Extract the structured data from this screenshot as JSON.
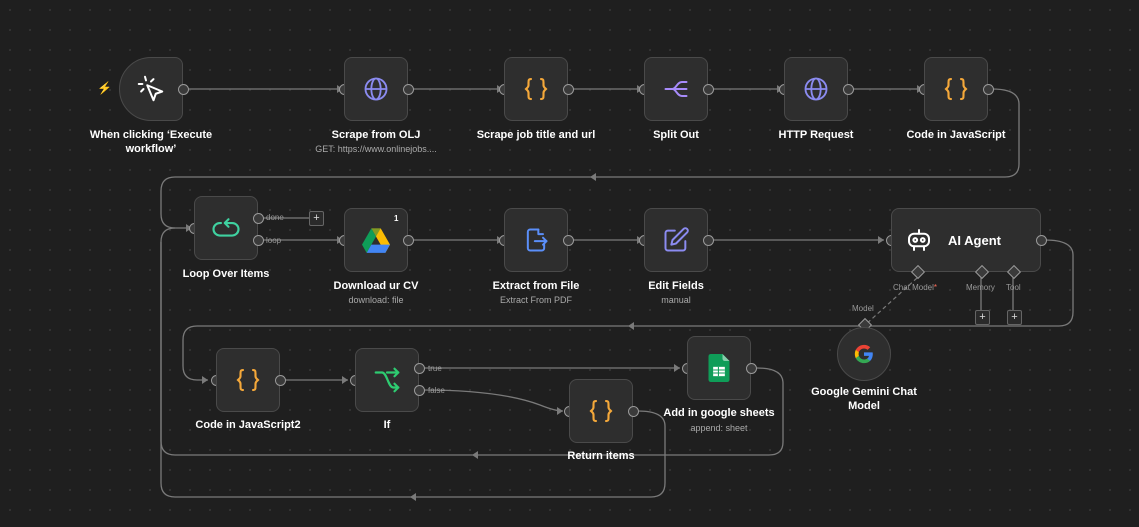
{
  "nodes": {
    "trigger": {
      "label": "When clicking ‘Execute workflow’",
      "icon": "cursor-click-icon"
    },
    "scrape_olj": {
      "label": "Scrape from OLJ",
      "subtitle": "GET: https://www.onlinejobs....",
      "icon": "globe-icon"
    },
    "scrape_title": {
      "label": "Scrape job title and url",
      "icon": "code-braces-icon"
    },
    "split_out": {
      "label": "Split Out",
      "icon": "split-icon"
    },
    "http_request": {
      "label": "HTTP Request",
      "icon": "globe-icon"
    },
    "code_js": {
      "label": "Code in JavaScript",
      "icon": "code-braces-icon"
    },
    "loop": {
      "label": "Loop Over Items",
      "icon": "loop-icon",
      "out_done": "done",
      "out_loop": "loop"
    },
    "download_cv": {
      "label": "Download ur CV",
      "subtitle": "download: file",
      "badge": "1",
      "icon": "google-drive-icon"
    },
    "extract_file": {
      "label": "Extract from File",
      "subtitle": "Extract From PDF",
      "icon": "file-export-icon"
    },
    "edit_fields": {
      "label": "Edit Fields",
      "subtitle": "manual",
      "icon": "pencil-edit-icon"
    },
    "ai_agent": {
      "label": "AI Agent",
      "icon": "robot-icon",
      "port_chat_model": "Chat Model",
      "port_memory": "Memory",
      "port_tool": "Tool",
      "required_mark": "*"
    },
    "gemini": {
      "label": "Google Gemini Chat Model",
      "port_model": "Model",
      "icon": "google-g-icon"
    },
    "code_js2": {
      "label": "Code in JavaScript2",
      "icon": "code-braces-icon"
    },
    "if_node": {
      "label": "If",
      "icon": "branch-icon",
      "out_true": "true",
      "out_false": "false"
    },
    "sheets": {
      "label": "Add in google sheets",
      "subtitle": "append: sheet",
      "icon": "google-sheets-icon"
    },
    "return_items": {
      "label": "Return items",
      "icon": "code-braces-icon"
    }
  },
  "colors": {
    "background": "#1f1f1f",
    "node_bg": "#2e2e2e",
    "edge": "#7a7a7a",
    "accent_orange": "#ff6d2d",
    "code_yellow": "#f4a83a",
    "globe_purple": "#8b8bf0",
    "loop_green": "#3fd1a0",
    "if_green": "#2ecc71"
  },
  "add_symbol": "+"
}
